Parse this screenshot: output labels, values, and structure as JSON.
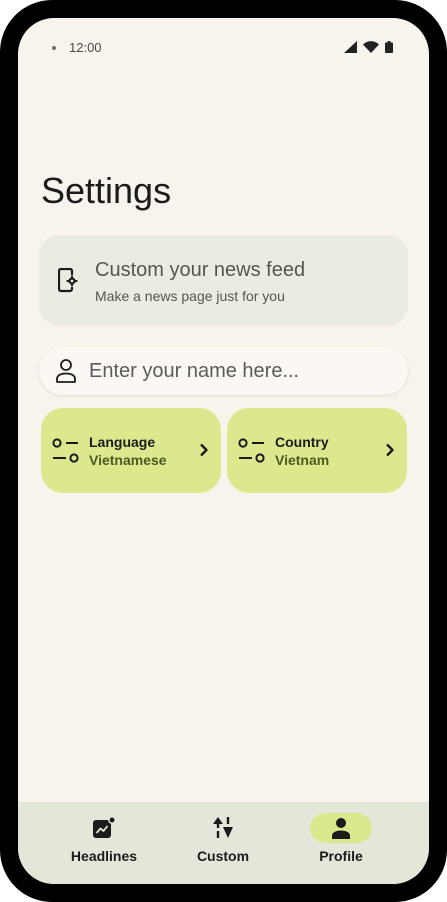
{
  "status_bar": {
    "time": "12:00"
  },
  "page": {
    "title": "Settings"
  },
  "feed_card": {
    "title": "Custom your news feed",
    "subtitle": "Make a news page just for you"
  },
  "name_input": {
    "placeholder": "Enter your name here...",
    "value": ""
  },
  "options": [
    {
      "label": "Language",
      "value": "Vietnamese"
    },
    {
      "label": "Country",
      "value": "Vietnam"
    }
  ],
  "bottom_nav": {
    "selected": "Profile",
    "items": [
      {
        "label": "Headlines",
        "icon": "trending-icon"
      },
      {
        "label": "Custom",
        "icon": "shapes-icon"
      },
      {
        "label": "Profile",
        "icon": "person-icon"
      }
    ]
  },
  "colors": {
    "background": "#f8f3ec",
    "card": "#ecebe2",
    "accent": "#dde88e",
    "nav_background": "#e5e6da"
  }
}
